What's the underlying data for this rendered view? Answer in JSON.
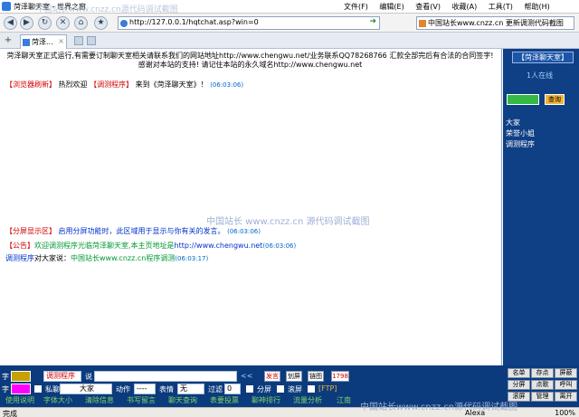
{
  "window": {
    "title": "菏泽聊天室 - 世界之窗",
    "watermark": "中国站长www.cnzz.cn源代码调试截图",
    "menus": [
      "文件(F)",
      "编辑(E)",
      "查看(V)",
      "收藏(A)",
      "工具(T)",
      "帮助(H)"
    ]
  },
  "toolbar": {
    "address": "http://127.0.0.1/hqtchat.asp?win=0",
    "search": "中国站长www.cnzz.cn 更新调测代码截图"
  },
  "tabs": [
    {
      "label": "菏泽..."
    }
  ],
  "chat": {
    "notice": "菏泽聊天室正式运行,有需要订制聊天室相关请联系我们的网站地址http://www.chengwu.net/业务联系QQ78268766 汇款全部完后有合法的合同签字! 感谢对本站的支持! 请记住本站的永久域名http://www.chengwu.net",
    "welcome": {
      "tag": "【浏览器刷新】",
      "text1": " 热烈欢迎 ",
      "user": "【调测程序】",
      "text2": " 来到《菏泽聊天室》！",
      "time": "(06:03:06)"
    },
    "split": {
      "tag": "【分屏显示区】",
      "text": " 启用分屏功能时，此区域用于显示与你有关的发言。",
      "time": "(06:03:06)"
    },
    "announce": {
      "tag": "【公告】",
      "text1": "欢迎调测程序光临菏泽聊天室,本主页地址是",
      "url": "http://www.chengwu.net",
      "time": "(06:03:06)"
    },
    "message": {
      "user": "调测程序",
      "text1": "对大家说：",
      "content": "中国站长www.cnzz.cn程序调测",
      "time": "(06:03:17)"
    },
    "watermark": "中国站长 www.cnzz.cn 源代码调试截图"
  },
  "sidebar": {
    "title": "【菏泽聊天室】",
    "online": "1人在线",
    "query": "查询",
    "users": [
      "大家",
      "荣誉小姐",
      "调测程序"
    ]
  },
  "bottom": {
    "row1": {
      "to_label": "字",
      "speaker": "调测程序",
      "say_label": "说",
      "send": "发言",
      "clear": "划屏",
      "link": "链图",
      "len": "1798"
    },
    "row2": {
      "color_label": "字",
      "quiet": "私聊",
      "target": "大家",
      "action_label": "动作",
      "action": "----",
      "emote_label": "表情",
      "emote": "无",
      "filter_label": "过滤",
      "filter": "0",
      "split": "分屏",
      "scroll": "滚屏",
      "ftp": "[FTP]"
    },
    "row3": [
      "使用说明",
      "字体大小",
      "清除信息",
      "书写留言",
      "聊天查询",
      "表要投票",
      "聊神排行",
      "流量分析",
      "江南"
    ]
  },
  "side_buttons": [
    "名单",
    "存点",
    "屏蔽",
    "分屏",
    "点歌",
    "呼叫",
    "滚屏",
    "管理",
    "离开"
  ],
  "status": {
    "left": "完成",
    "zoom": "100%",
    "alexa": "Alexa"
  },
  "colors": {
    "sidebar_bg": "#0f3f84",
    "bottom_bg": "#0b3b7c",
    "accent_red": "#d40000"
  }
}
